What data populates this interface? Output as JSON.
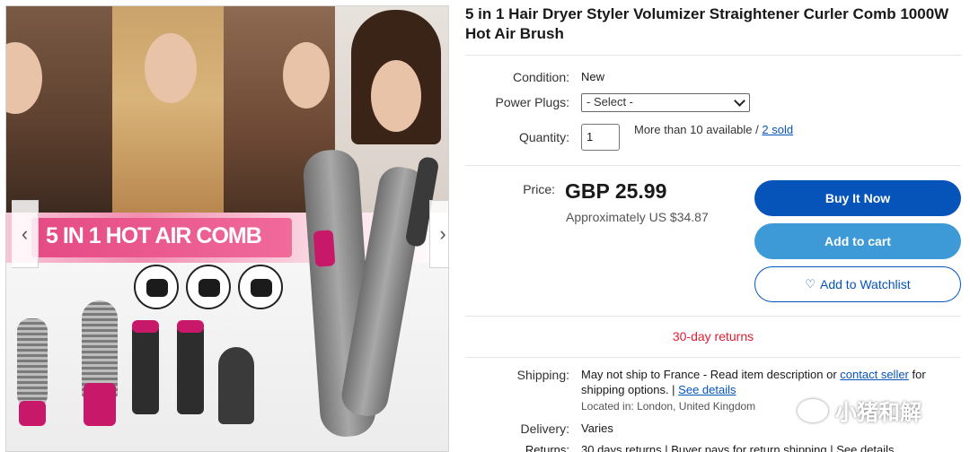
{
  "listing": {
    "title": "5 in 1 Hair Dryer Styler Volumizer Straightener Curler Comb 1000W Hot Air Brush"
  },
  "gallery": {
    "banner_text": "5 IN 1 HOT AIR COMB",
    "prev_icon": "chevron-left-icon",
    "next_icon": "chevron-right-icon"
  },
  "details": {
    "condition_label": "Condition:",
    "condition_value": "New",
    "power_plugs_label": "Power Plugs:",
    "power_plugs_selected": "- Select -",
    "quantity_label": "Quantity:",
    "quantity_value": "1",
    "availability_text": "More than 10 available / ",
    "sold_link": "2 sold"
  },
  "pricing": {
    "price_label": "Price:",
    "price": "GBP 25.99",
    "approx": "Approximately US $34.87"
  },
  "actions": {
    "buy_now": "Buy It Now",
    "add_to_cart": "Add to cart",
    "add_to_watchlist": "Add to Watchlist",
    "watch_icon": "heart-icon"
  },
  "returns_banner": "30-day returns",
  "shipping": {
    "shipping_label": "Shipping:",
    "shipping_text_1": "May not ship to France - Read item description or ",
    "contact_seller": "contact seller",
    "shipping_text_2": " for shipping options. | ",
    "see_details": "See details",
    "located_label": "Located in:",
    "located_value": "London, United Kingdom",
    "delivery_label": "Delivery:",
    "delivery_value": "Varies",
    "returns_label": "Returns:",
    "returns_value": "30 days returns | Buyer pays for return shipping | See details"
  },
  "watermark": {
    "text": "小猪和解",
    "icon": "wechat-icon"
  },
  "colors": {
    "ebay_blue": "#0654ba",
    "cart_blue": "#3d9ad6",
    "returns_red": "#dd1e31",
    "product_pink": "#c8186a"
  }
}
